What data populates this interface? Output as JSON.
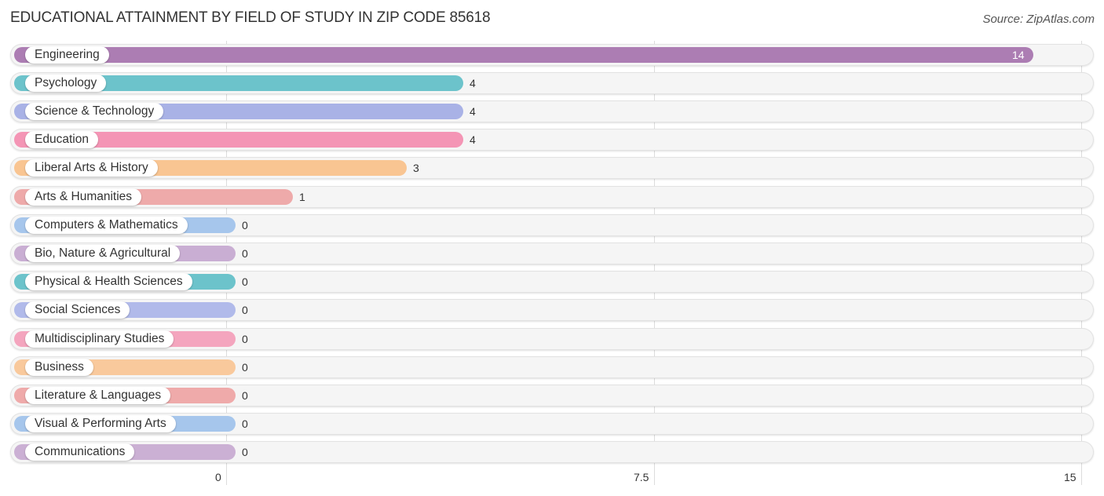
{
  "header": {
    "title": "EDUCATIONAL ATTAINMENT BY FIELD OF STUDY IN ZIP CODE 85618",
    "source": "Source: ZipAtlas.com"
  },
  "chart_data": {
    "type": "bar",
    "orientation": "horizontal",
    "title": "EDUCATIONAL ATTAINMENT BY FIELD OF STUDY IN ZIP CODE 85618",
    "xlabel": "",
    "ylabel": "",
    "xlim": [
      0,
      15
    ],
    "xticks": [
      0,
      7.5,
      15
    ],
    "xtick_labels": [
      "0",
      "7.5",
      "15"
    ],
    "grid": true,
    "categories": [
      "Engineering",
      "Psychology",
      "Science & Technology",
      "Education",
      "Liberal Arts & History",
      "Arts & Humanities",
      "Computers & Mathematics",
      "Bio, Nature & Agricultural",
      "Physical & Health Sciences",
      "Social Sciences",
      "Multidisciplinary Studies",
      "Business",
      "Literature & Languages",
      "Visual & Performing Arts",
      "Communications"
    ],
    "values": [
      14,
      4,
      4,
      4,
      3,
      1,
      0,
      0,
      0,
      0,
      0,
      0,
      0,
      0,
      0
    ],
    "value_labels": [
      "14",
      "4",
      "4",
      "4",
      "3",
      "1",
      "0",
      "0",
      "0",
      "0",
      "0",
      "0",
      "0",
      "0",
      "0"
    ],
    "colors": [
      "#ac7db3",
      "#6cc3cb",
      "#a9b2e6",
      "#f495b5",
      "#f9c592",
      "#eeaaaa",
      "#a6c6ec",
      "#c9aed3",
      "#6cc3cb",
      "#b1baea",
      "#f4a5be",
      "#f9c99c",
      "#efaaaa",
      "#a6c6ec",
      "#cbb0d4"
    ]
  }
}
